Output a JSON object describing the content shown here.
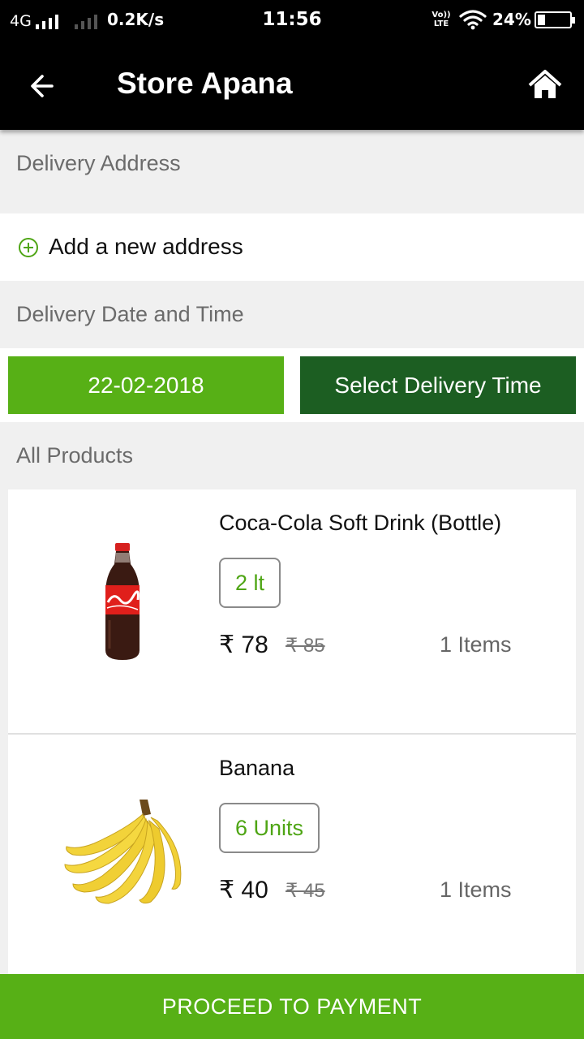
{
  "status_bar": {
    "network": "4G",
    "speed": "0.2K/s",
    "time": "11:56",
    "volte_top": "Vo))",
    "volte_bottom": "LTE",
    "battery": "24%",
    "battery_level": 0.24
  },
  "app_bar": {
    "title": "Store Apana",
    "back_icon": "arrow-left-icon",
    "home_icon": "home-icon"
  },
  "delivery_address": {
    "heading": "Delivery Address",
    "add_label": "Add a new address"
  },
  "delivery_datetime": {
    "heading": "Delivery Date and Time",
    "date": "22-02-2018",
    "time_button": "Select Delivery Time"
  },
  "products": {
    "heading": "All Products",
    "items": [
      {
        "name": "Coca-Cola Soft Drink (Bottle)",
        "quantity": "2 lt",
        "price": "₹ 78",
        "mrp": "₹ 85",
        "count": "1 Items",
        "image": "coca-cola-bottle"
      },
      {
        "name": "Banana",
        "quantity": "6 Units",
        "price": "₹ 40",
        "mrp": "₹ 45",
        "count": "1 Items",
        "image": "banana-bunch"
      }
    ]
  },
  "footer": {
    "proceed": "PROCEED TO PAYMENT"
  },
  "colors": {
    "primary_green": "#57b016",
    "dark_green": "#1c5e22",
    "app_bar": "#000000"
  }
}
